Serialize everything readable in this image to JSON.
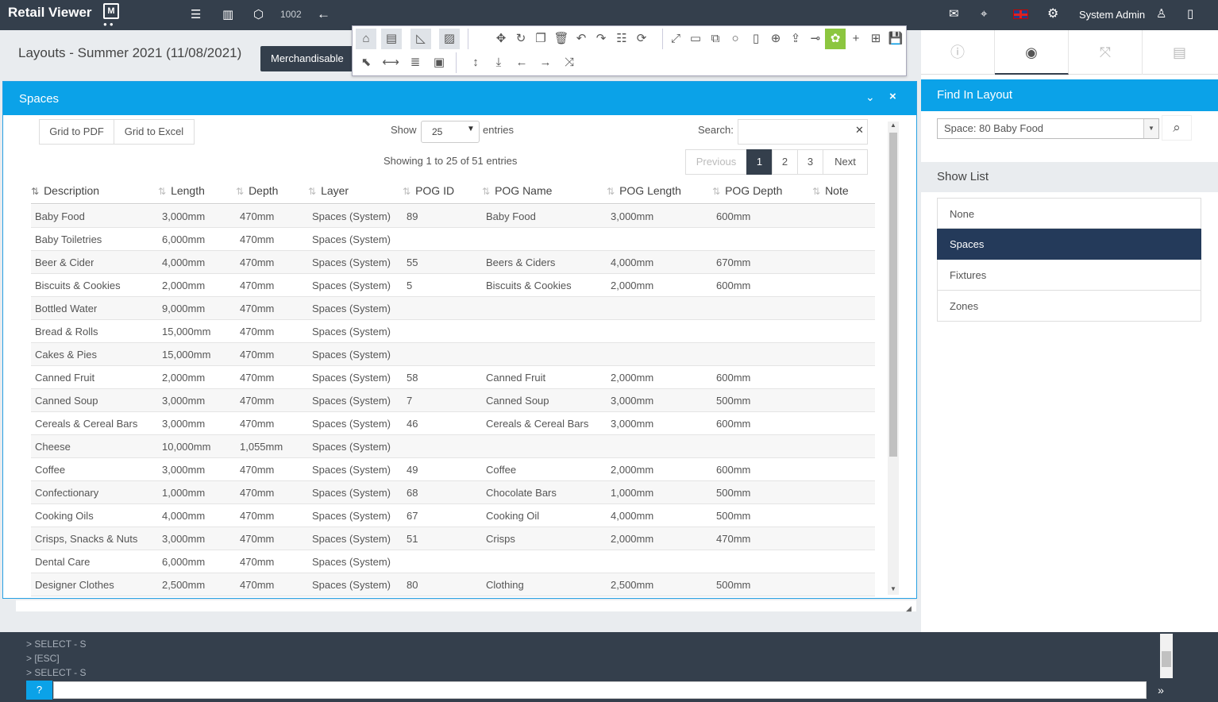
{
  "app": {
    "title": "Retail Viewer",
    "logo_mark": "M",
    "layout_number": "1002",
    "user": "System Admin"
  },
  "header": {
    "title": "Layouts - Summer 2021 (11/08/2021)",
    "merchandisable_button": "Merchandisable"
  },
  "spaces": {
    "title": "Spaces",
    "grid_pdf": "Grid to PDF",
    "grid_excel": "Grid to Excel",
    "show_label": "Show",
    "show_value": "25",
    "entries_label": "entries",
    "search_label": "Search:",
    "showing": "Showing 1 to 25 of 51 entries",
    "pager": {
      "previous": "Previous",
      "pages": [
        "1",
        "2",
        "3"
      ],
      "next": "Next",
      "current": "1"
    },
    "columns": [
      "Description",
      "Length",
      "Depth",
      "Layer",
      "POG ID",
      "POG Name",
      "POG Length",
      "POG Depth",
      "Note"
    ],
    "rows": [
      [
        "Baby Food",
        "3,000mm",
        "470mm",
        "Spaces (System)",
        "89",
        "Baby Food",
        "3,000mm",
        "600mm",
        ""
      ],
      [
        "Baby Toiletries",
        "6,000mm",
        "470mm",
        "Spaces (System)",
        "",
        "",
        "",
        "",
        ""
      ],
      [
        "Beer & Cider",
        "4,000mm",
        "470mm",
        "Spaces (System)",
        "55",
        "Beers & Ciders",
        "4,000mm",
        "670mm",
        ""
      ],
      [
        "Biscuits & Cookies",
        "2,000mm",
        "470mm",
        "Spaces (System)",
        "5",
        "Biscuits & Cookies",
        "2,000mm",
        "600mm",
        ""
      ],
      [
        "Bottled Water",
        "9,000mm",
        "470mm",
        "Spaces (System)",
        "",
        "",
        "",
        "",
        ""
      ],
      [
        "Bread & Rolls",
        "15,000mm",
        "470mm",
        "Spaces (System)",
        "",
        "",
        "",
        "",
        ""
      ],
      [
        "Cakes & Pies",
        "15,000mm",
        "470mm",
        "Spaces (System)",
        "",
        "",
        "",
        "",
        ""
      ],
      [
        "Canned Fruit",
        "2,000mm",
        "470mm",
        "Spaces (System)",
        "58",
        "Canned Fruit",
        "2,000mm",
        "600mm",
        ""
      ],
      [
        "Canned Soup",
        "3,000mm",
        "470mm",
        "Spaces (System)",
        "7",
        "Canned Soup",
        "3,000mm",
        "500mm",
        ""
      ],
      [
        "Cereals & Cereal Bars",
        "3,000mm",
        "470mm",
        "Spaces (System)",
        "46",
        "Cereals & Cereal Bars",
        "3,000mm",
        "600mm",
        ""
      ],
      [
        "Cheese",
        "10,000mm",
        "1,055mm",
        "Spaces (System)",
        "",
        "",
        "",
        "",
        ""
      ],
      [
        "Coffee",
        "3,000mm",
        "470mm",
        "Spaces (System)",
        "49",
        "Coffee",
        "2,000mm",
        "600mm",
        ""
      ],
      [
        "Confectionary",
        "1,000mm",
        "470mm",
        "Spaces (System)",
        "68",
        "Chocolate Bars",
        "1,000mm",
        "500mm",
        ""
      ],
      [
        "Cooking Oils",
        "4,000mm",
        "470mm",
        "Spaces (System)",
        "67",
        "Cooking Oil",
        "4,000mm",
        "500mm",
        ""
      ],
      [
        "Crisps, Snacks & Nuts",
        "3,000mm",
        "470mm",
        "Spaces (System)",
        "51",
        "Crisps",
        "2,000mm",
        "470mm",
        ""
      ],
      [
        "Dental Care",
        "6,000mm",
        "470mm",
        "Spaces (System)",
        "",
        "",
        "",
        "",
        ""
      ],
      [
        "Designer Clothes",
        "2,500mm",
        "470mm",
        "Spaces (System)",
        "80",
        "Clothing",
        "2,500mm",
        "500mm",
        ""
      ]
    ]
  },
  "find": {
    "title": "Find In Layout",
    "selected": "Space: 80 Baby Food"
  },
  "show_list": {
    "title": "Show List",
    "items": [
      "None",
      "Spaces",
      "Fixtures",
      "Zones"
    ],
    "selected": "Spaces"
  },
  "console": {
    "lines": [
      "> SELECT - S",
      "> [ESC]",
      "> SELECT - S"
    ]
  },
  "colors": {
    "dark": "#343f4c",
    "accent": "#0ba2e8",
    "selected": "#243a5a",
    "active_tool": "#8cc63f"
  }
}
